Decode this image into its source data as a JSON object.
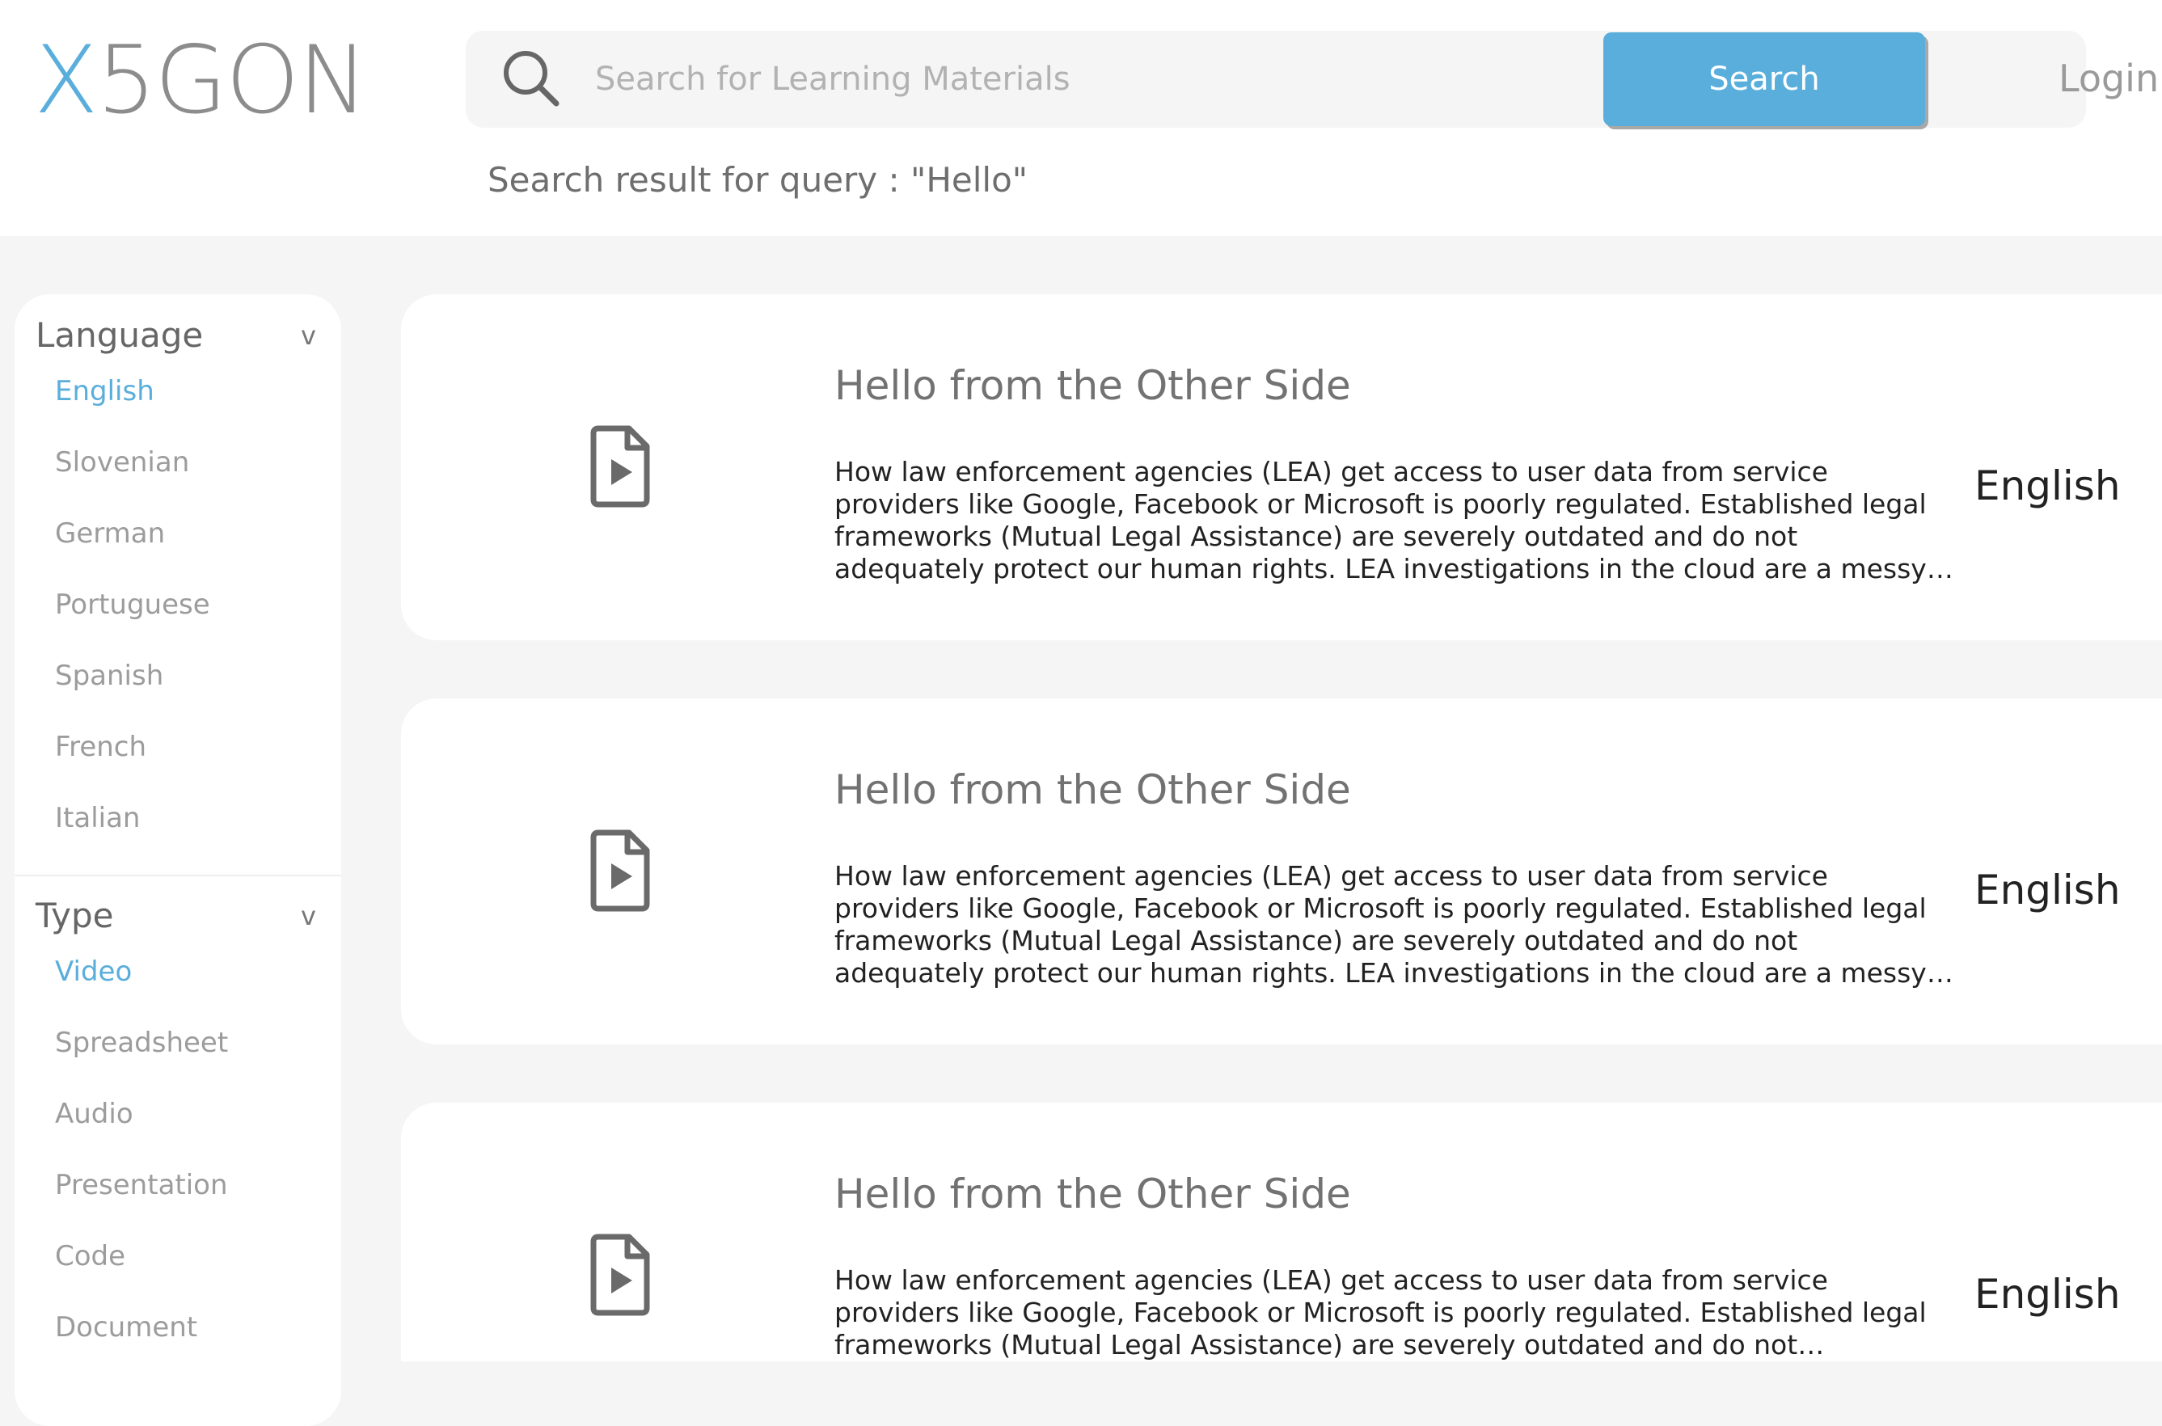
{
  "header": {
    "logo_x": "X",
    "logo_rest": "5GON",
    "search_placeholder": "Search for Learning Materials",
    "search_button": "Search",
    "login": "Login",
    "query_text": "Search result for query : \"Hello\""
  },
  "colors": {
    "accent": "#5aaedb",
    "background": "#f6f5f6",
    "card": "#ffffff"
  },
  "sidebar": {
    "language": {
      "title": "Language",
      "chevron": "v",
      "items": [
        "English",
        "Slovenian",
        "German",
        "Portuguese",
        "Spanish",
        "French",
        "Italian"
      ],
      "selected": "English"
    },
    "type": {
      "title": "Type",
      "chevron": "v",
      "items": [
        "Video",
        "Spreadsheet",
        "Audio",
        "Presentation",
        "Code",
        "Document"
      ],
      "selected": "Video"
    }
  },
  "results": [
    {
      "icon": "video-file-icon",
      "title": "Hello from the Other Side",
      "description": "How law enforcement agencies (LEA) get access to user data from service providers like Google, Facebook or Microsoft is poorly regulated. Established legal frameworks (Mutual Legal Assistance) are severely outdated and do not adequately protect our human rights. LEA investigations in the cloud are a messy business and currently...",
      "language": "English"
    },
    {
      "icon": "video-file-icon",
      "title": "Hello from the Other Side",
      "description": "How law enforcement agencies (LEA) get access to user data from service providers like Google, Facebook or Microsoft is poorly regulated. Established legal frameworks (Mutual Legal Assistance) are severely outdated and do not adequately protect our human rights. LEA investigations in the cloud are a messy business and currently...",
      "language": "English"
    },
    {
      "icon": "video-file-icon",
      "title": "Hello from the Other Side",
      "description": "How law enforcement agencies (LEA) get access to user data from service providers like Google, Facebook or Microsoft is poorly regulated. Established legal frameworks (Mutual Legal Assistance) are severely outdated and do not adequately protect our",
      "language": "English"
    }
  ]
}
